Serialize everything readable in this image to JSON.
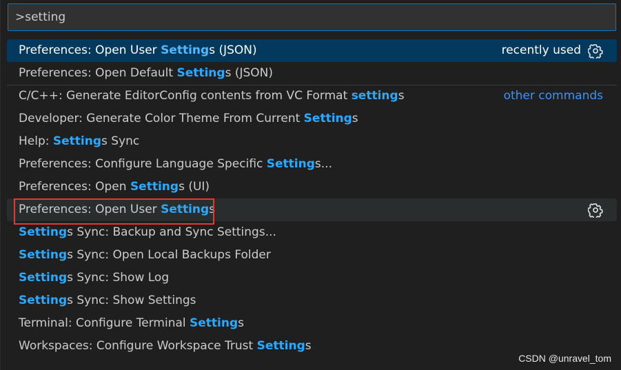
{
  "search": {
    "value": ">setting",
    "placeholder": ""
  },
  "items": [
    {
      "pre": "Preferences: Open User ",
      "hl": "Setting",
      "post": "s (JSON)",
      "tag": "recently used",
      "gear": true,
      "state": "selected"
    },
    {
      "pre": "Preferences: Open Default ",
      "hl": "Setting",
      "post": "s (JSON)"
    },
    {
      "pre": "C/C++: Generate EditorConfig contents from VC Format ",
      "hl": "setting",
      "post": "s",
      "tag": "other commands",
      "tag_style": "link",
      "separator": true
    },
    {
      "pre": "Developer: Generate Color Theme From Current ",
      "hl": "Setting",
      "post": "s"
    },
    {
      "pre": "Help: ",
      "hl": "Setting",
      "post": "s Sync"
    },
    {
      "pre": "Preferences: Configure Language Specific ",
      "hl": "Setting",
      "post": "s..."
    },
    {
      "pre": "Preferences: Open ",
      "hl": "Setting",
      "post": "s (UI)"
    },
    {
      "pre": "Preferences: Open User ",
      "hl": "Setting",
      "post": "s",
      "gear": true,
      "state": "hovered",
      "annotated": true
    },
    {
      "pre": "",
      "hl": "Setting",
      "post": "s Sync: Backup and Sync Settings..."
    },
    {
      "pre": "",
      "hl": "Setting",
      "post": "s Sync: Open Local Backups Folder"
    },
    {
      "pre": "",
      "hl": "Setting",
      "post": "s Sync: Show Log"
    },
    {
      "pre": "",
      "hl": "Setting",
      "post": "s Sync: Show Settings"
    },
    {
      "pre": "Terminal: Configure Terminal ",
      "hl": "Setting",
      "post": "s"
    },
    {
      "pre": "Workspaces: Configure Workspace Trust ",
      "hl": "Setting",
      "post": "s"
    }
  ],
  "watermark": "CSDN @unravel_tom",
  "colors": {
    "highlight": "#2aaaff",
    "selected_bg": "#04395e",
    "annotation": "#e53935"
  },
  "icons": {
    "gear": "gear-icon"
  }
}
